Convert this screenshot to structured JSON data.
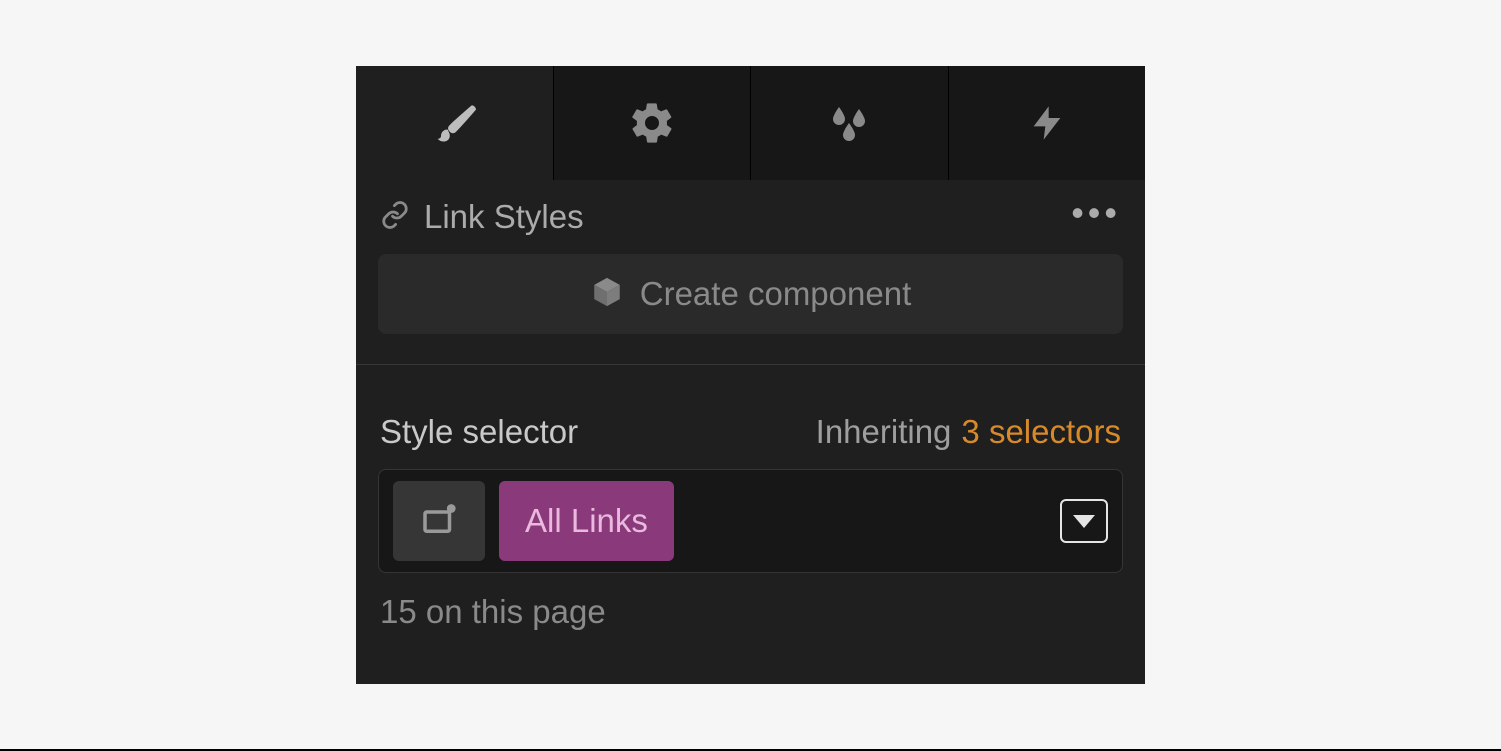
{
  "header": {
    "title": "Link Styles"
  },
  "create": {
    "label": "Create component"
  },
  "selector": {
    "label": "Style selector",
    "inheriting_label": "Inheriting",
    "inheriting_value": "3 selectors",
    "tag": "All Links",
    "count_text": "15 on this page"
  }
}
